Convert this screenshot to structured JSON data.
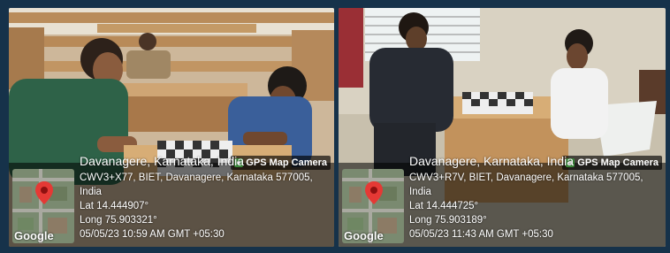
{
  "photos": [
    {
      "camera_badge": "GPS Map Camera",
      "map_label": "Google",
      "location_title": "Davanagere, Karnataka, India",
      "address": "CWV3+X77, BIET, Davanagere, Karnataka 577005, India",
      "lat": "Lat 14.444907°",
      "long": "Long 75.903321°",
      "timestamp": "05/05/23 10:59 AM GMT +05:30"
    },
    {
      "camera_badge": "GPS Map Camera",
      "map_label": "Google",
      "location_title": "Davanagere, Karnataka, India",
      "address": "CWV3+R7V, BIET, Davanagere, Karnataka 577005, India",
      "lat": "Lat 14.444725°",
      "long": "Long 75.903189°",
      "timestamp": "05/05/23 11:43 AM GMT +05:30"
    }
  ],
  "colors": {
    "background": "#16324a",
    "map_pin": "#e53935",
    "camera_icon": "#3d8f3d"
  }
}
